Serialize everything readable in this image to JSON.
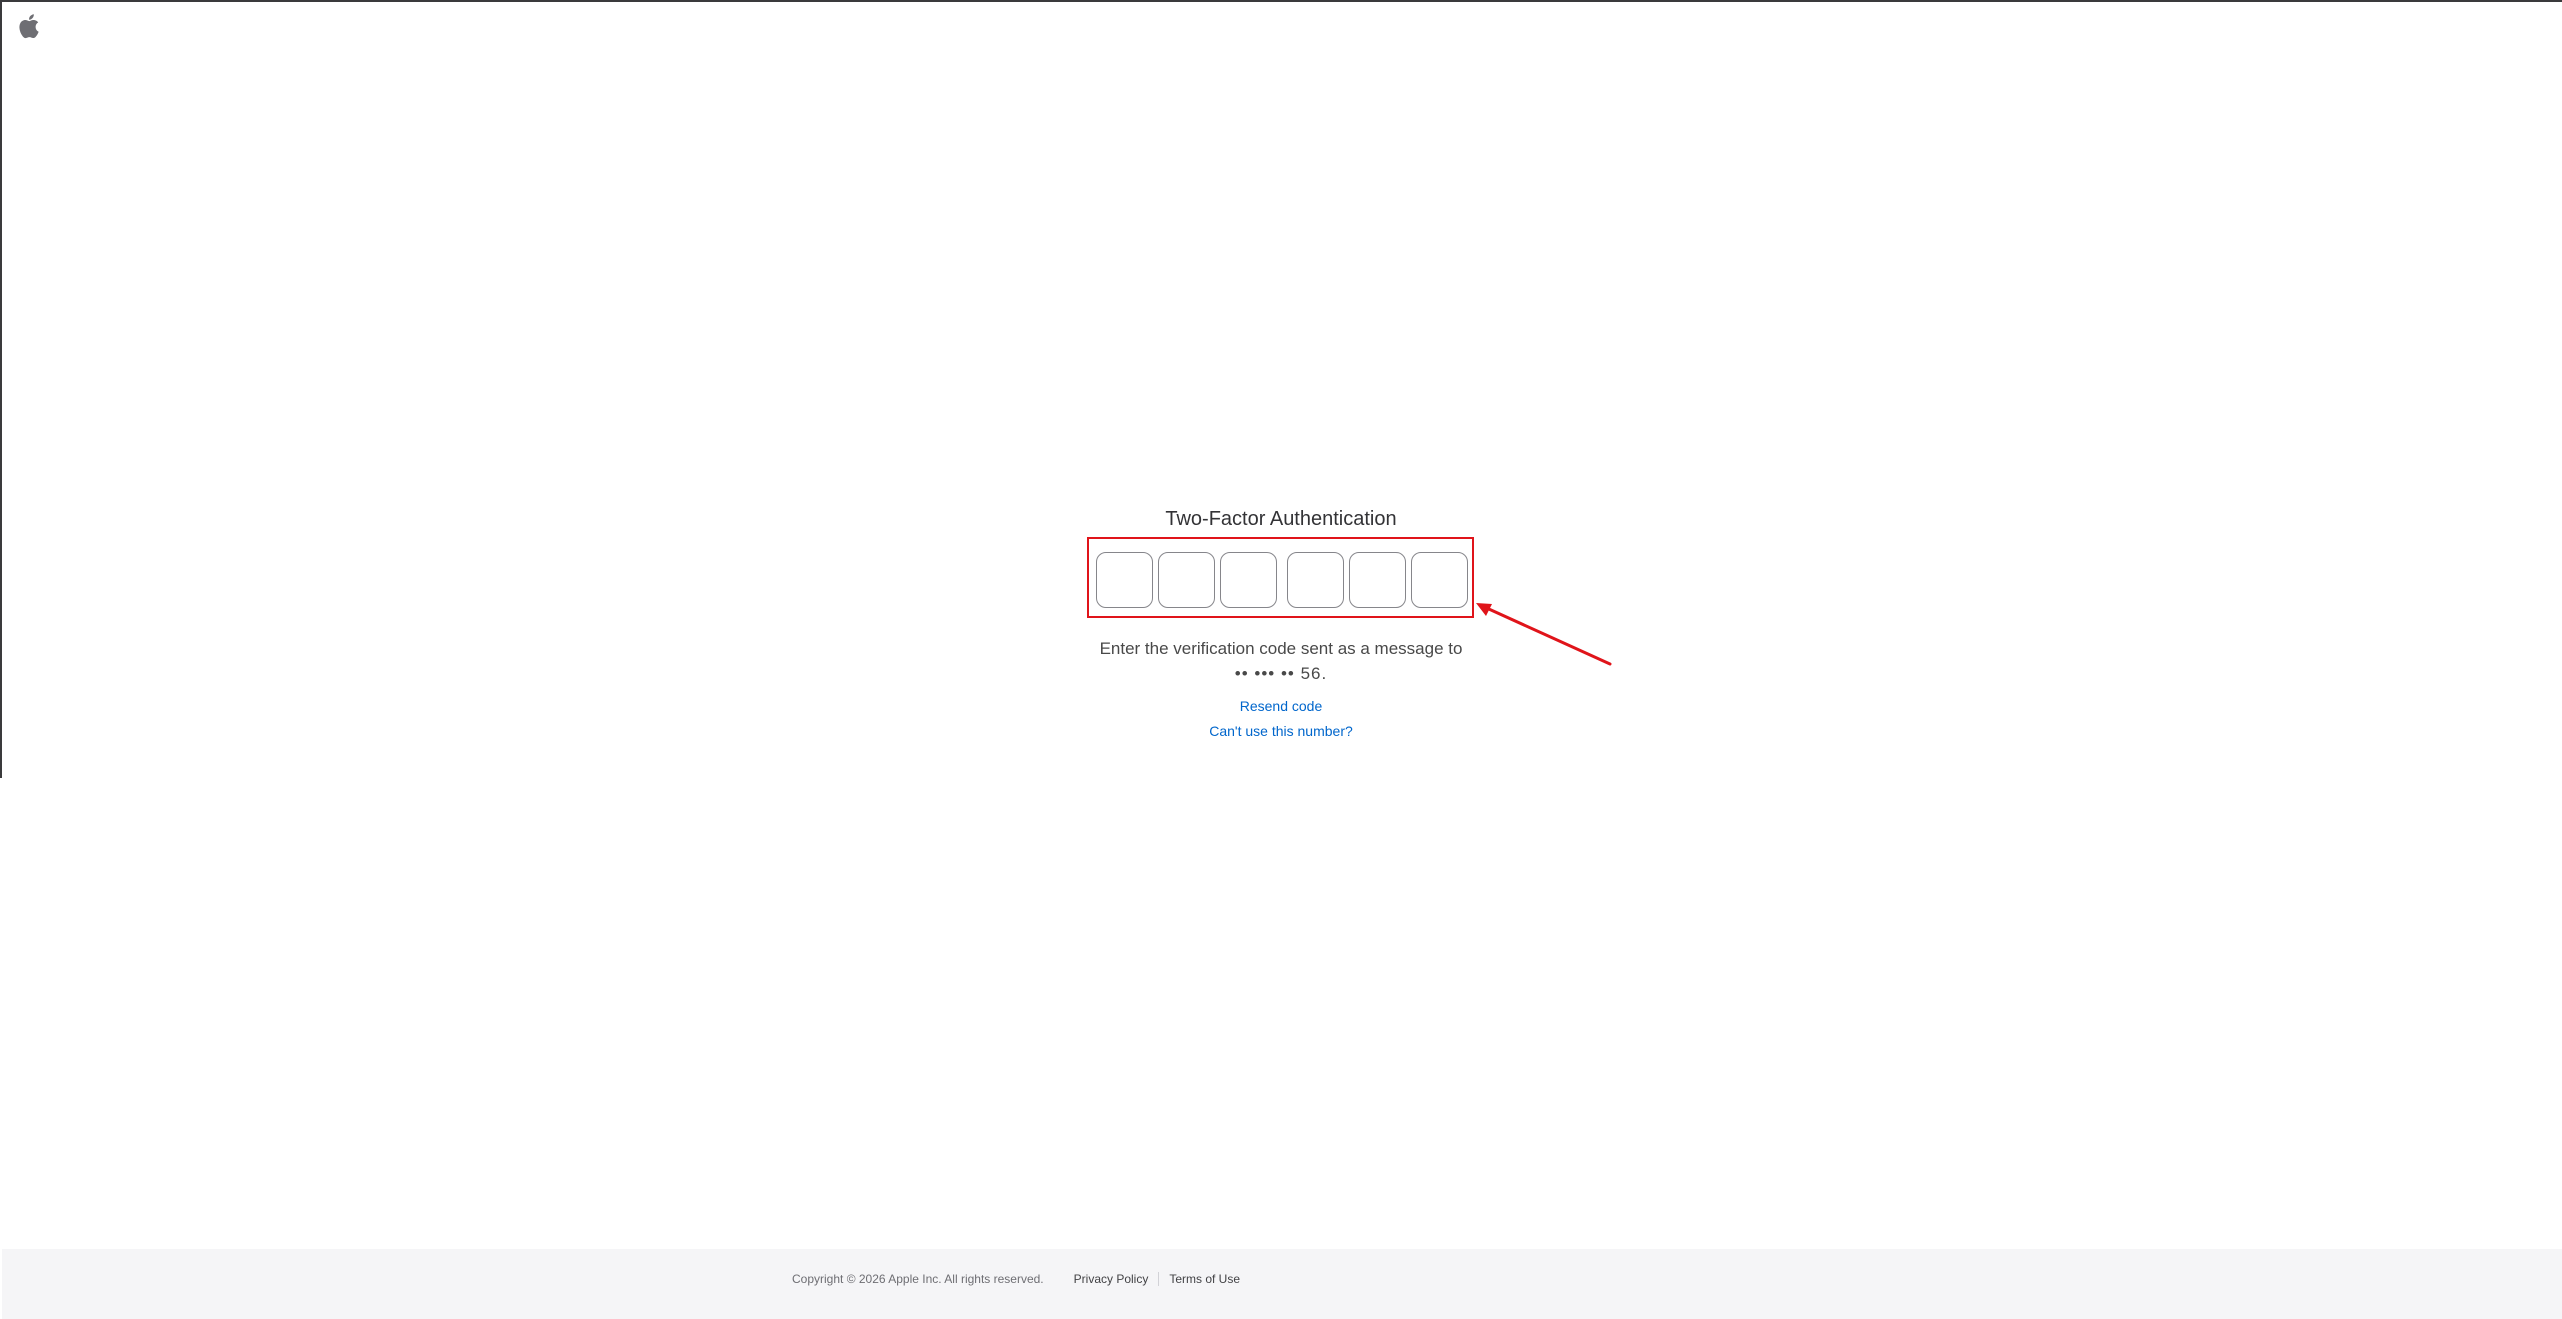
{
  "header": {
    "logo_icon": "apple-logo-icon"
  },
  "auth": {
    "title": "Two-Factor Authentication",
    "code_digits": [
      "",
      "",
      "",
      "",
      "",
      ""
    ],
    "instruction_line1": "Enter the verification code sent as a message to",
    "instruction_line2": "•• ••• •• 56.",
    "resend_label": "Resend code",
    "cant_use_label": "Can't use this number?"
  },
  "annotation": {
    "highlight_color": "#e0141a"
  },
  "footer": {
    "copyright": "Copyright © 2026 Apple Inc. All rights reserved.",
    "privacy_label": "Privacy Policy",
    "terms_label": "Terms of Use"
  },
  "colors": {
    "link": "#0066cc",
    "footer_bg": "#f5f5f7"
  }
}
